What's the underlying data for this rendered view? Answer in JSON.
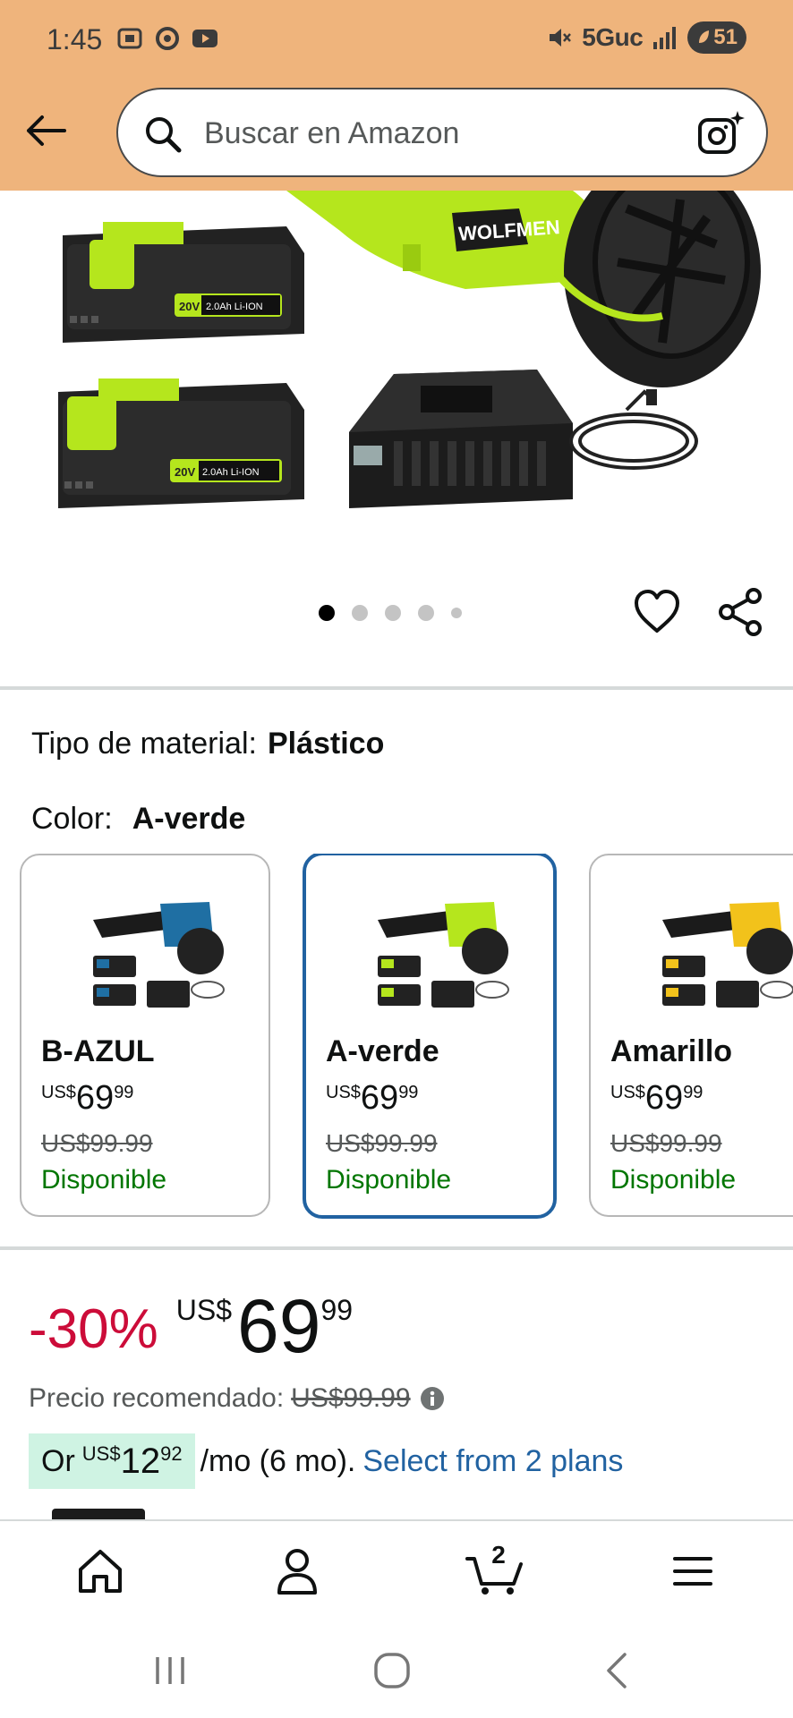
{
  "status_bar": {
    "time": "1:45",
    "network": "5Guc",
    "battery": "51"
  },
  "header": {
    "search_placeholder": "Buscar en Amazon"
  },
  "gallery": {
    "image_count": 5,
    "active_index": 0,
    "brand_text": "WOLFMEN",
    "battery_label": "20V 2.0Ah Li-ION"
  },
  "attributes": {
    "material_label": "Tipo de material:",
    "material_value": "Plástico",
    "color_label": "Color:",
    "color_value": "A-verde"
  },
  "swatches": [
    {
      "name": "B-AZUL",
      "currency": "US$",
      "whole": "69",
      "fraction": "99",
      "list_price": "US$99.99",
      "availability": "Disponible",
      "color": "#1F6FA3",
      "selected": false
    },
    {
      "name": "A-verde",
      "currency": "US$",
      "whole": "69",
      "fraction": "99",
      "list_price": "US$99.99",
      "availability": "Disponible",
      "color": "#B5E61D",
      "selected": true
    },
    {
      "name": "Amarillo",
      "currency": "US$",
      "whole": "69",
      "fraction": "99",
      "list_price": "US$99.99",
      "availability": "Disponible",
      "color": "#F2C21B",
      "selected": false
    }
  ],
  "price": {
    "discount": "-30%",
    "currency": "US$",
    "whole": "69",
    "fraction": "99",
    "rrp_label": "Precio recomendado:",
    "rrp_value": "US$99.99"
  },
  "installments": {
    "prefix": "Or",
    "currency": "US$",
    "whole": "12",
    "fraction": "92",
    "suffix": "/mo (6 mo).",
    "link": "Select from 2 plans"
  },
  "bottom_nav": {
    "cart_count": "2"
  },
  "colors": {
    "header_bg": "#EFB47C",
    "discount": "#CC0C39",
    "link": "#2162A1",
    "available": "#007600",
    "selected_border": "#2162A1",
    "plan_chip": "#CFF3E3"
  }
}
